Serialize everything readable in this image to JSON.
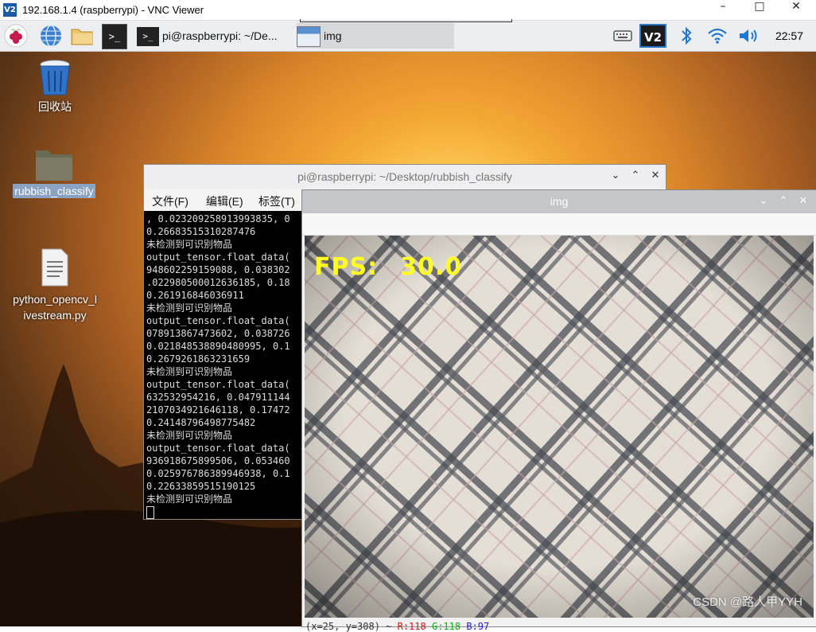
{
  "vnc": {
    "title": "192.168.1.4 (raspberrypi) - VNC Viewer",
    "logo": "V2",
    "minimize": "–",
    "maximize": "□",
    "close": "✕"
  },
  "taskbar": {
    "terminal_task": "pi@raspberrypi: ~/De...",
    "img_task": "img",
    "clock": "22:57",
    "vnc_logo": "V2",
    "terminal_glyph": ">_"
  },
  "desktop": {
    "icons": [
      {
        "label": "回收站"
      },
      {
        "label": "rubbish_classify"
      },
      {
        "label": "python_opencv_l\nivestream.py"
      }
    ]
  },
  "terminal": {
    "title": "pi@raspberrypi: ~/Desktop/rubbish_classify",
    "menu": [
      "文件(F)",
      "编辑(E)",
      "标签(T)"
    ],
    "output": [
      ", 0.023209258913993835, 0",
      "0.26683515310287476",
      "未检测到可识别物品",
      "output_tensor.float_data(",
      "948602259159088, 0.038302",
      ".022980500012636185, 0.18",
      "0.261916846036911",
      "未检测到可识别物品",
      "output_tensor.float_data(",
      "078913867473602, 0.038726",
      "0.021848538890480995, 0.1",
      "0.2679261863231659",
      "未检测到可识别物品",
      "output_tensor.float_data(",
      "632532954216, 0.047911144",
      "2107034921646118, 0.17472",
      "0.24148796498775482",
      "未检测到可识别物品",
      "output_tensor.float_data(",
      "936918675899506, 0.053460",
      "0.025976786389946938, 0.1",
      "0.22633859515190125",
      "未检测到可识别物品"
    ]
  },
  "imgwin": {
    "title": "img",
    "fps_label": "FPS:",
    "fps_value": "30.0",
    "status_prefix": "(x=25, y=308) ~",
    "status_r": "R:118",
    "status_g": "G:118",
    "status_b": "B:97"
  },
  "watermark": "CSDN @路人甲YYH"
}
